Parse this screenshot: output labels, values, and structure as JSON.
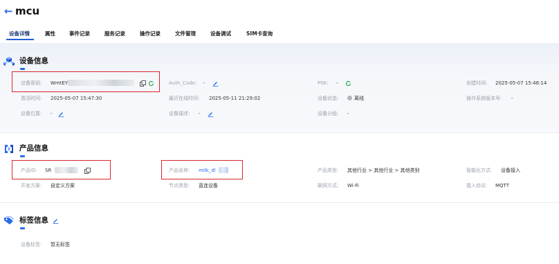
{
  "header": {
    "back_icon": "arrow-left-icon",
    "title": "mcu"
  },
  "tabs": [
    {
      "label": "设备详情",
      "active": true
    },
    {
      "label": "属性"
    },
    {
      "label": "事件记录"
    },
    {
      "label": "服务记录"
    },
    {
      "label": "操作记录"
    },
    {
      "label": "文件管理"
    },
    {
      "label": "设备调试"
    },
    {
      "label": "SIM卡查询"
    }
  ],
  "device_info": {
    "title": "设备信息",
    "icon": "device-cubes-icon",
    "key_label": "设备密钥:",
    "key_value": "WmtEY",
    "auth_label": "Auth_Code:",
    "auth_value": "-",
    "psk_label": "PSK:",
    "psk_value": "-",
    "created_label": "创建时间:",
    "created_value": "2025-05-07 15:46:14",
    "activated_label": "激活时间:",
    "activated_value": "2025-05-07 15:47:30",
    "last_online_label": "最近在线时间:",
    "last_online_value": "2025-05-11 21:29:02",
    "status_label": "设备状态:",
    "status_value": "离线",
    "os_label": "操作系统版本号:",
    "os_value": "-",
    "location_label": "设备位置:",
    "location_value": "-",
    "desc_label": "设备描述:",
    "desc_value": "-",
    "group_label": "设备分组:",
    "group_value": "-"
  },
  "product_info": {
    "title": "产品信息",
    "icon": "product-box-icon",
    "id_label": "产品ID:",
    "id_value": "SR",
    "name_label": "产品名称:",
    "name_value": "milk_dl",
    "type_label": "产品类型:",
    "type_value": "其他行业 > 其他行业 > 其他类别",
    "smart_label": "智能化方式:",
    "smart_value": "设备接入",
    "dev_label": "开发方案:",
    "dev_value": "自定义方案",
    "node_label": "节点类型:",
    "node_value": "直连设备",
    "net_label": "联网方式:",
    "net_value": "Wi-Fi",
    "protocol_label": "接入协议:",
    "protocol_value": "MQTT"
  },
  "tag_info": {
    "title": "标签信息",
    "icon": "tag-icon",
    "tag_label": "设备标签:",
    "tag_value": "暂无标签"
  },
  "colors": {
    "accent": "#2a6ae9",
    "highlight": "#d9262c",
    "refresh": "#2fa84f"
  }
}
